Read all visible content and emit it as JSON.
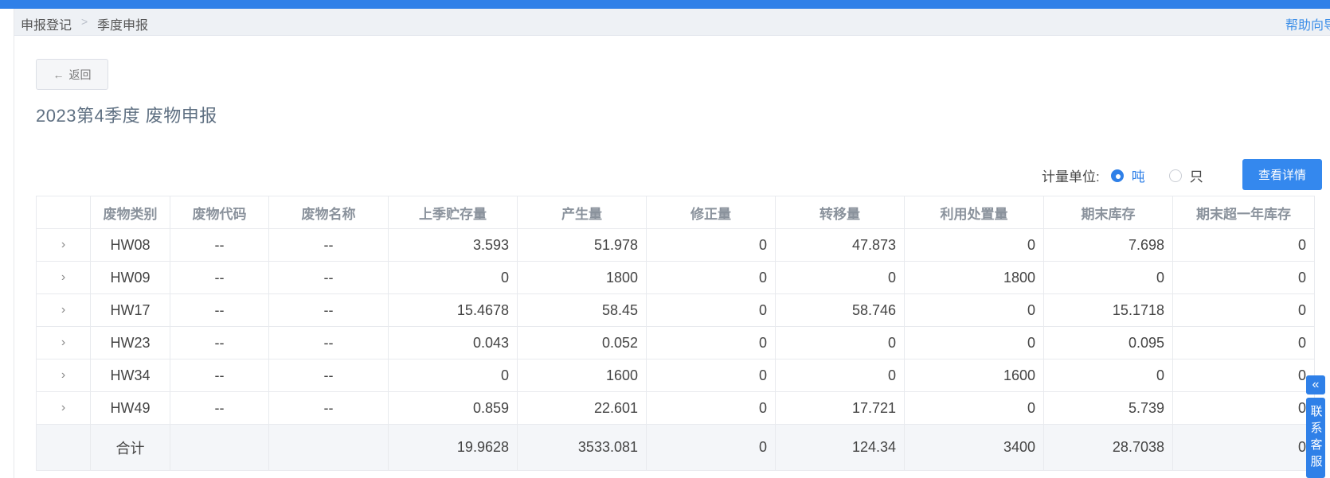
{
  "breadcrumb": {
    "item1": "申报登记",
    "separator": ">",
    "item2": "季度申报"
  },
  "help_link": "帮助向导",
  "back_button": {
    "icon": "arrow-left-icon",
    "label": "返回"
  },
  "page_title": "2023第4季度  废物申报",
  "unit": {
    "label": "计量单位:",
    "options": [
      {
        "label": "吨",
        "selected": true
      },
      {
        "label": "只",
        "selected": false
      }
    ]
  },
  "detail_button": "查看详情",
  "table": {
    "headers": [
      "",
      "废物类别",
      "废物代码",
      "废物名称",
      "上季贮存量",
      "产生量",
      "修正量",
      "转移量",
      "利用处置量",
      "期末库存",
      "期末超一年库存"
    ],
    "rows": [
      {
        "expand": "›",
        "category": "HW08",
        "code": "--",
        "name": "--",
        "prev_storage": "3.593",
        "produced": "51.978",
        "corrected": "0",
        "transferred": "47.873",
        "disposed": "0",
        "end_stock": "7.698",
        "over_year": "0"
      },
      {
        "expand": "›",
        "category": "HW09",
        "code": "--",
        "name": "--",
        "prev_storage": "0",
        "produced": "1800",
        "corrected": "0",
        "transferred": "0",
        "disposed": "1800",
        "end_stock": "0",
        "over_year": "0"
      },
      {
        "expand": "›",
        "category": "HW17",
        "code": "--",
        "name": "--",
        "prev_storage": "15.4678",
        "produced": "58.45",
        "corrected": "0",
        "transferred": "58.746",
        "disposed": "0",
        "end_stock": "15.1718",
        "over_year": "0"
      },
      {
        "expand": "›",
        "category": "HW23",
        "code": "--",
        "name": "--",
        "prev_storage": "0.043",
        "produced": "0.052",
        "corrected": "0",
        "transferred": "0",
        "disposed": "0",
        "end_stock": "0.095",
        "over_year": "0"
      },
      {
        "expand": "›",
        "category": "HW34",
        "code": "--",
        "name": "--",
        "prev_storage": "0",
        "produced": "1600",
        "corrected": "0",
        "transferred": "0",
        "disposed": "1600",
        "end_stock": "0",
        "over_year": "0"
      },
      {
        "expand": "›",
        "category": "HW49",
        "code": "--",
        "name": "--",
        "prev_storage": "0.859",
        "produced": "22.601",
        "corrected": "0",
        "transferred": "17.721",
        "disposed": "0",
        "end_stock": "5.739",
        "over_year": "0"
      }
    ],
    "total": {
      "label": "合计",
      "prev_storage": "19.9628",
      "produced": "3533.081",
      "corrected": "0",
      "transferred": "124.34",
      "disposed": "3400",
      "end_stock": "28.7038",
      "over_year": "0"
    }
  },
  "customer_service": {
    "collapse_icon": "double-chevron-left-icon",
    "label": "联系客服"
  },
  "colors": {
    "accent": "#2f80e8",
    "header_bg": "#eef1f5",
    "title": "#5f7082"
  }
}
